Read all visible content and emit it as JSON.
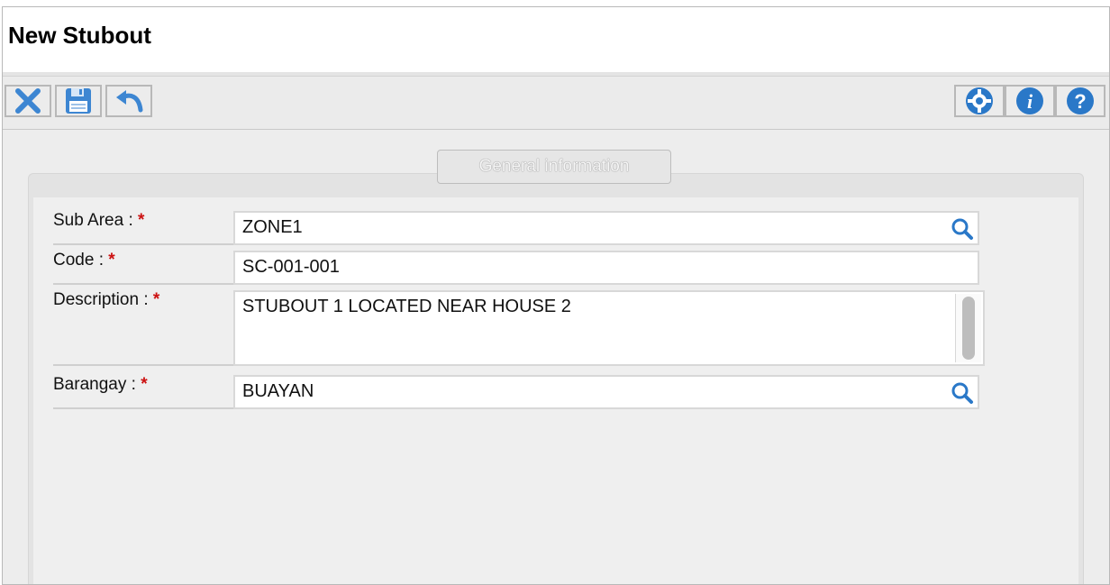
{
  "window": {
    "title": "New Stubout"
  },
  "toolbar": {
    "left": [
      {
        "name": "close",
        "icon": "close-x-icon"
      },
      {
        "name": "save",
        "icon": "floppy-disk-icon"
      },
      {
        "name": "undo",
        "icon": "undo-arrow-icon"
      }
    ],
    "right": [
      {
        "name": "settings",
        "icon": "gear-icon"
      },
      {
        "name": "info",
        "icon": "info-icon"
      },
      {
        "name": "help",
        "icon": "question-icon"
      }
    ]
  },
  "tab": {
    "label": "General information"
  },
  "form": {
    "required_mark": "*",
    "sub_area": {
      "label": "Sub Area :",
      "value": "ZONE1"
    },
    "code": {
      "label": "Code :",
      "value": "SC-001-001"
    },
    "description": {
      "label": "Description :",
      "value": "STUBOUT 1 LOCATED NEAR HOUSE 2"
    },
    "barangay": {
      "label": "Barangay :",
      "value": "BUAYAN"
    }
  },
  "colors": {
    "accent": "#2a78c8",
    "required": "#cc1111"
  }
}
